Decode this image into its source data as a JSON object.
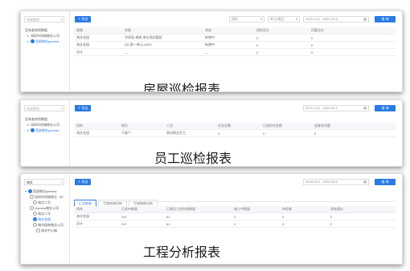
{
  "panels": [
    {
      "search_placeholder": "快速查找",
      "tree": [
        {
          "label": "没有查询到数据",
          "type": "text"
        },
        {
          "label": "深圳市尚城物业公司",
          "type": "caret"
        },
        {
          "label": "西部物业gamma",
          "type": "caret-radio"
        }
      ],
      "export_label": "导出",
      "selects": [
        {
          "label": "楼栋"
        },
        {
          "label": "单元/楼层"
        }
      ],
      "date_label": "2018-12-0 - 2020-03-0",
      "query_label": "查 询",
      "table": {
        "headers": [
          "楼阁",
          "房屋",
          "状态",
          "巡检总计",
          "问题总计"
        ],
        "rows": [
          [
            "海文花园",
            "华润县-城南-单位测试楼组",
            "新增中",
            "0",
            "0"
          ],
          [
            "海文花园",
            "AD-第一单元-A023",
            "新增中",
            "0",
            "0"
          ],
          [
            "总计",
            "—",
            "—",
            "0",
            "0"
          ]
        ]
      },
      "caption": "房屋巡检报表"
    },
    {
      "search_placeholder": "快速查找",
      "tree": [
        {
          "label": "没有查询到数据",
          "type": "text"
        },
        {
          "label": "深圳市尚城物业公司",
          "type": "caret"
        },
        {
          "label": "西部物业gamma",
          "type": "caret-radio"
        }
      ],
      "export_label": "导出",
      "date_label": "2019-12-0 - 2020-03-0",
      "query_label": "查 询",
      "table": {
        "headers": [
          "机构",
          "岗位",
          "人员",
          "任务总数",
          "已巡检任务数",
          "巡查发问题"
        ],
        "rows": [
          [
            "海文花园",
            "干部个",
            "测试物业员工",
            "2",
            "0",
            "0"
          ]
        ]
      },
      "caption": "员工巡检报表"
    },
    {
      "search_value": "海文",
      "tree": [
        {
          "label": "西部物业gamma",
          "type": "radio-on"
        },
        {
          "label": "深圳市尚城物业（8）",
          "type": "radio"
        },
        {
          "label": "海文二号",
          "type": "radio"
        },
        {
          "label": "Gamma物业公司",
          "type": "radio"
        },
        {
          "label": "海文二号",
          "type": "radio"
        },
        {
          "label": "海文花园",
          "type": "radio-on"
        },
        {
          "label": "城市园林物业公司",
          "type": "radio"
        },
        {
          "label": "海文中心城",
          "type": "radio"
        }
      ],
      "export_label": "导出",
      "date_label": "2019-09-0 - 2020-03-0",
      "query_label": "查 询",
      "tabs": [
        "汇总报表",
        "工程申请分析",
        "工程报修分析"
      ],
      "table": {
        "headers": [
          "机构",
          "已发布数量",
          "已建议工程申请数量",
          "施工中数量",
          "待验收",
          "验收通过"
        ],
        "rows": [
          [
            "海文花园",
            "297",
            "61",
            "2",
            "4",
            "2"
          ],
          [
            "总计",
            "297",
            "61",
            "2",
            "4",
            "2"
          ]
        ]
      },
      "caption": "工程分析报表"
    }
  ],
  "colors": {
    "accent": "#2a7be4",
    "border": "#dcdcdc"
  }
}
